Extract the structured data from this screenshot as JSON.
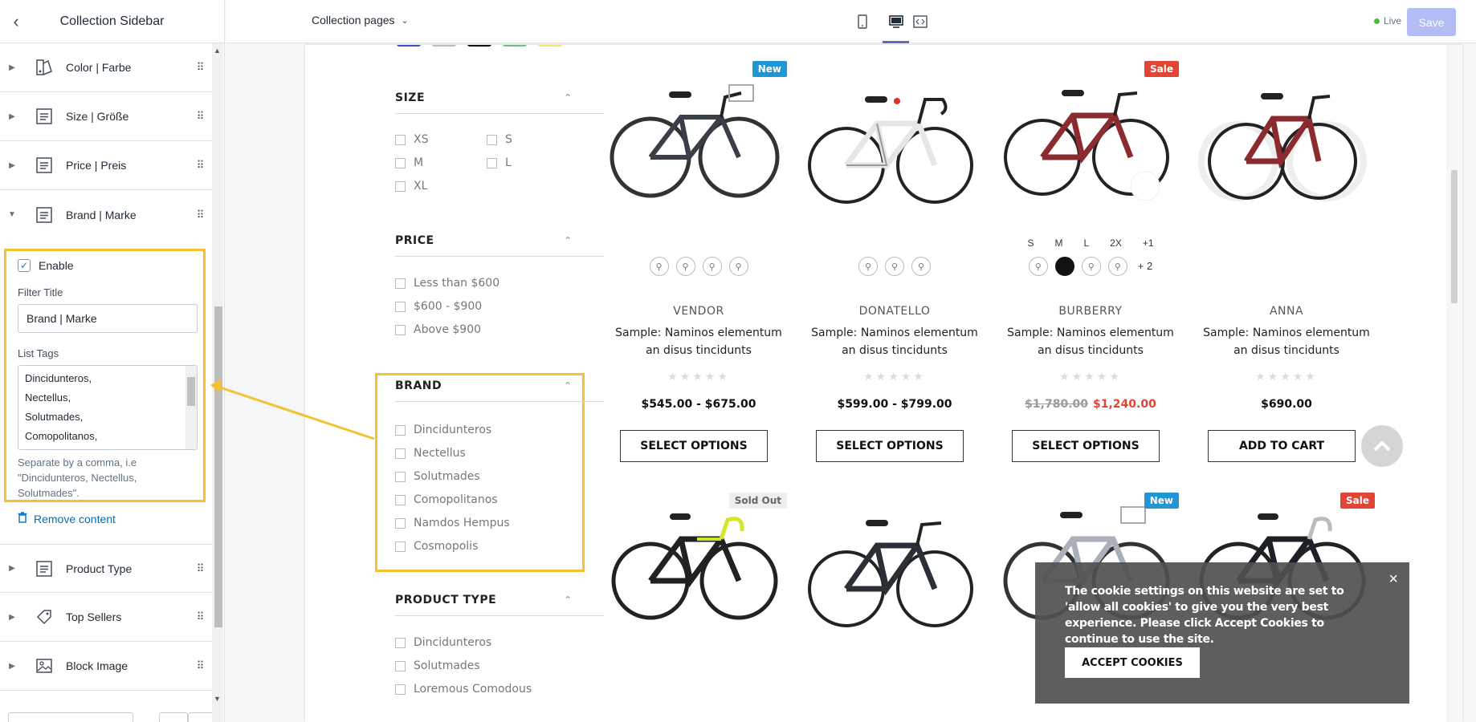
{
  "editor": {
    "title": "Collection Sidebar",
    "sections": [
      {
        "label": "Color | Farbe",
        "icon": "color-swatch-icon"
      },
      {
        "label": "Size | Größe",
        "icon": "text-block-icon"
      },
      {
        "label": "Price | Preis",
        "icon": "text-block-icon"
      },
      {
        "label": "Brand | Marke",
        "icon": "text-block-icon"
      }
    ],
    "brand_panel": {
      "enable_label": "Enable",
      "filter_title_label": "Filter Title",
      "filter_title_value": "Brand | Marke",
      "list_tags_label": "List Tags",
      "list_tags_lines": [
        "Dincidunteros,",
        "Nectellus,",
        "Solutmades,",
        "Comopolitanos,"
      ],
      "help": "Separate by a comma, i.e \"Dincidunteros, Nectellus, Solutmades\"."
    },
    "remove_label": "Remove content",
    "sections_below": [
      {
        "label": "Product Type",
        "icon": "text-block-icon"
      },
      {
        "label": "Top Sellers",
        "icon": "tag-icon"
      },
      {
        "label": "Block Image",
        "icon": "image-icon"
      }
    ]
  },
  "topbar": {
    "template_select": "Collection pages",
    "live_label": "Live",
    "save_label": "Save"
  },
  "filters": {
    "size": {
      "title": "SIZE",
      "options": [
        "XS",
        "S",
        "M",
        "L",
        "XL"
      ]
    },
    "price": {
      "title": "PRICE",
      "options": [
        "Less than $600",
        "$600 - $900",
        "Above $900"
      ]
    },
    "brand": {
      "title": "BRAND",
      "options": [
        "Dincidunteros",
        "Nectellus",
        "Solutmades",
        "Comopolitanos",
        "Namdos Hempus",
        "Cosmopolis"
      ]
    },
    "product_type": {
      "title": "PRODUCT TYPE",
      "options": [
        "Dincidunteros",
        "Solutmades",
        "Loremous Comodous"
      ]
    }
  },
  "products": [
    {
      "vendor": "VENDOR",
      "title": "Sample: Naminos elementum an disus tincidunts",
      "price": "$545.00 - $675.00",
      "button": "SELECT OPTIONS",
      "badge": "New"
    },
    {
      "vendor": "DONATELLO",
      "title": "Sample: Naminos elementum an disus tincidunts",
      "price": "$599.00 - $799.00",
      "button": "SELECT OPTIONS",
      "badge": ""
    },
    {
      "vendor": "BURBERRY",
      "title": "Sample: Naminos elementum an disus tincidunts",
      "old_price": "$1,780.00",
      "price": "$1,240.00",
      "button": "SELECT OPTIONS",
      "badge": "Sale",
      "sizes": [
        "S",
        "M",
        "L",
        "2X",
        "+1"
      ],
      "more_colors": "+ 2"
    },
    {
      "vendor": "ANNA",
      "title": "Sample: Naminos elementum an disus tincidunts",
      "price": "$690.00",
      "button": "ADD TO CART",
      "badge": ""
    }
  ],
  "products_row2_badges": [
    "Sold Out",
    "",
    "New",
    "Sale"
  ],
  "cookie": {
    "text": "The cookie settings on this website are set to 'allow all cookies' to give you the very best experience. Please click Accept Cookies to continue to use the site.",
    "button": "ACCEPT COOKIES"
  },
  "colors": {
    "accent": "#5c6ac4",
    "highlight": "#f5c130",
    "sale": "#e04535",
    "new": "#2196d3"
  }
}
